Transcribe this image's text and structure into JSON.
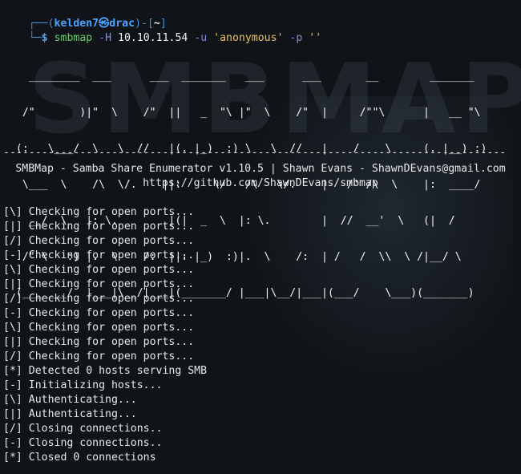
{
  "prompt": {
    "top_left": "┌──(",
    "user_host": "kelden7㉿drac",
    "mid": ")-[",
    "dir": "~",
    "end": "]",
    "bottom": "└─",
    "dollar": "$"
  },
  "command": {
    "program": "smbmap",
    "flag_host": "-H",
    "host": "10.10.11.54",
    "flag_user": "-u",
    "user": "'anonymous'",
    "flag_pass": "-p",
    "pass": "''"
  },
  "banner_lines": [
    "    ________  ___      ___  _______   ___      ___       __        _______",
    "   /\"       )|\"  \\    /\"  ||   _  \"\\ |\"  \\    /\"  |     /\"\"\\      |   __ \"\\",
    "  (:   \\___/  \\   \\  //   |(. |_)  :) \\   \\  //   |    /    \\     (. |__) :)",
    "   \\___  \\    /\\  \\/.    ||:     \\/   /\\   \\/.    |   /' /\\  \\    |:  ____/",
    "    __/  \\   |: \\.        |(|  _  \\  |: \\.        |  //  __'  \\   (|  /",
    "   /\" \\   :) |.  \\    /:  ||: |_)  :)|.  \\    /:  | /   /  \\\\  \\ /|__/ \\",
    "  (_______/  |___|\\__/|___|(_______/ |___|\\__/|___|(___/    \\___)(_______)"
  ],
  "banner_shadow": "SMBMAP",
  "separator": "-------------------------------------------------------------------------------",
  "info_line": "SMBMap - Samba Share Enumerator v1.10.5 | Shawn Evans - ShawnDEvans@gmail.com",
  "url_line": "https://github.com/ShawnDEvans/smbmap",
  "output": [
    "[\\] Checking for open ports...",
    "[|] Checking for open ports...",
    "[/] Checking for open ports...",
    "[-] Checking for open ports...",
    "[\\] Checking for open ports...",
    "[|] Checking for open ports...",
    "[/] Checking for open ports...",
    "[-] Checking for open ports...",
    "[\\] Checking for open ports...",
    "[|] Checking for open ports...",
    "[/] Checking for open ports...",
    "[*] Detected 0 hosts serving SMB",
    "[-] Initializing hosts...",
    "[\\] Authenticating...",
    "[|] Authenticating...",
    "[/] Closing connections..",
    "[-] Closing connections..",
    "[*] Closed 0 connections"
  ],
  "colors": {
    "background": "#101418",
    "prompt_blue": "#4da3ff",
    "command_green": "#5fd35f",
    "string_yellow": "#e8c05a",
    "flag_blue": "#7a8fd6"
  }
}
